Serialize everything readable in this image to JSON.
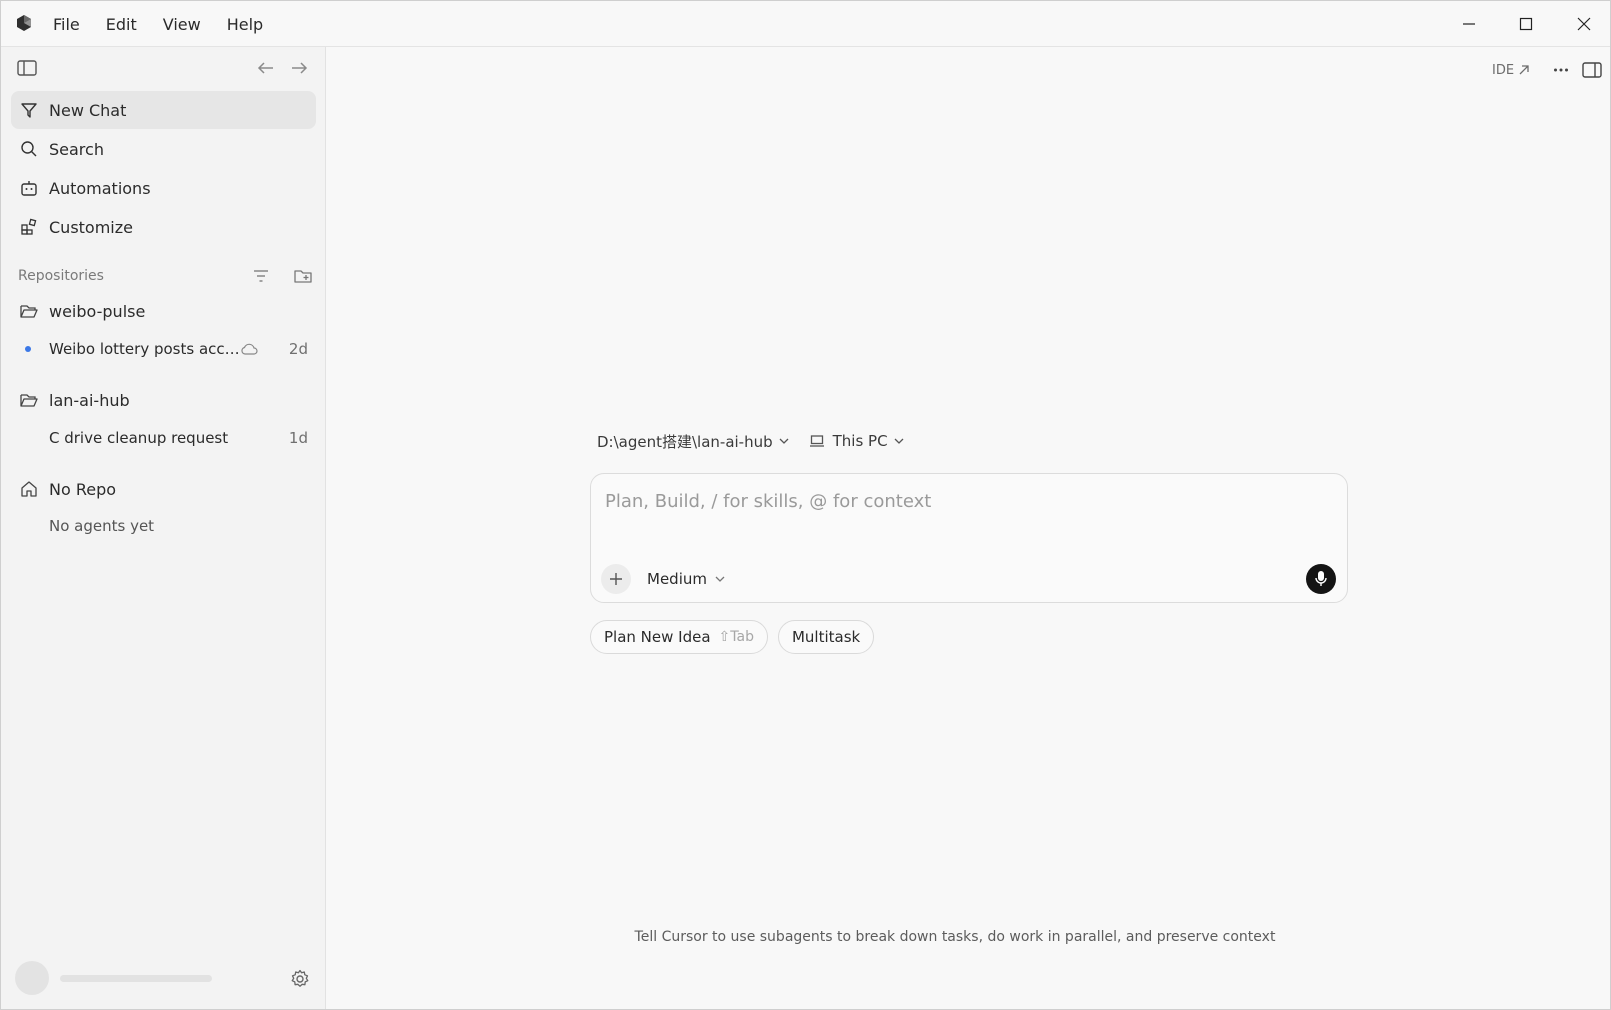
{
  "menus": [
    "File",
    "Edit",
    "View",
    "Help"
  ],
  "sidebar": {
    "nav": [
      {
        "label": "New Chat",
        "icon": "new-chat-icon",
        "active": true
      },
      {
        "label": "Search",
        "icon": "search-icon"
      },
      {
        "label": "Automations",
        "icon": "robot-icon"
      },
      {
        "label": "Customize",
        "icon": "apps-icon"
      }
    ],
    "repositories_title": "Repositories",
    "repos": [
      {
        "name": "weibo-pulse",
        "chats": [
          {
            "title": "Weibo lottery posts acco...",
            "age": "2d",
            "cloud": true,
            "dot": true
          }
        ]
      },
      {
        "name": "lan-ai-hub",
        "chats": [
          {
            "title": "C drive cleanup request",
            "age": "1d",
            "cloud": false,
            "dot": false
          }
        ]
      }
    ],
    "no_repo": {
      "label": "No Repo",
      "empty": "No agents yet"
    }
  },
  "main": {
    "ide_label": "IDE",
    "context_path": "D:\\agent搭建\\lan-ai-hub",
    "context_host": "This PC",
    "composer": {
      "placeholder": "Plan, Build, / for skills, @ for context",
      "model": "Medium"
    },
    "chips": [
      {
        "label": "Plan New Idea",
        "shortcut": "⇧Tab"
      },
      {
        "label": "Multitask",
        "shortcut": ""
      }
    ],
    "tip": "Tell Cursor to use subagents to break down tasks, do work in parallel, and preserve context"
  },
  "colors": {
    "accent_dot": "#3b78e7",
    "mic_bg": "#141414"
  }
}
